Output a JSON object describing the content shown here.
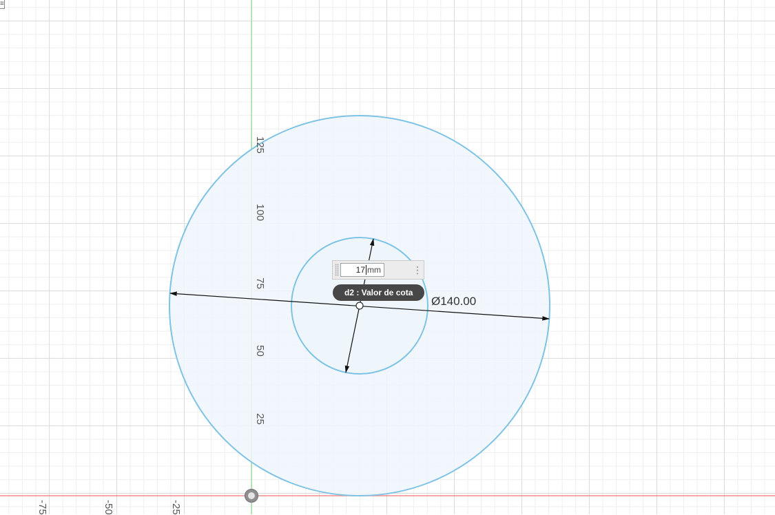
{
  "ruler": {
    "y_labels": [
      "125",
      "100",
      "75",
      "50",
      "25"
    ],
    "x_labels": [
      "-75",
      "-50",
      "-25"
    ]
  },
  "dimension": {
    "diameter_label": "Ø140.00",
    "input_value": "17",
    "input_unit": "mm"
  },
  "tooltip": {
    "text": "d2 : Valor de cota"
  },
  "colors": {
    "circle_stroke": "#7ec3e6",
    "profile_fill": "#eef6fc",
    "y_axis": "#9fe0a0",
    "x_axis": "#f08b8b",
    "dimension_line": "#111111"
  },
  "icons": {
    "origin": "origin-icon",
    "menu": "more-vertical-icon"
  }
}
